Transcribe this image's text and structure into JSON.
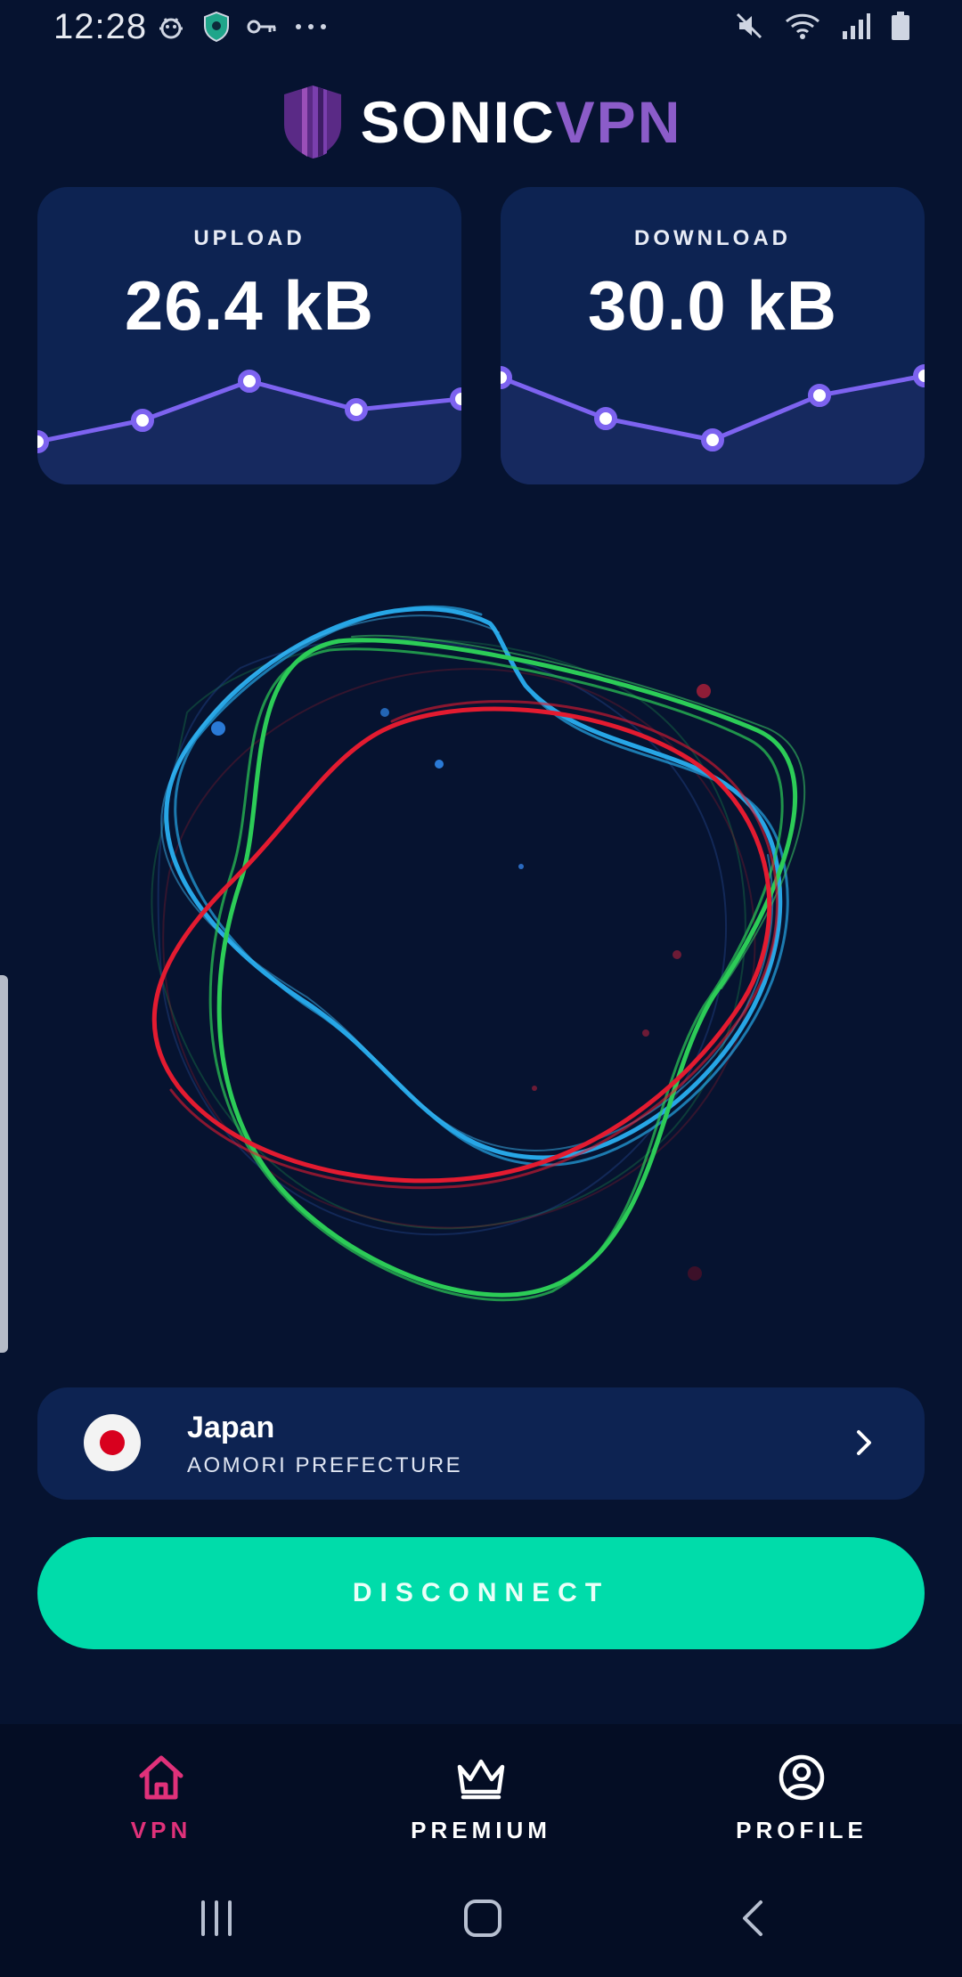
{
  "status_bar": {
    "time": "12:28",
    "left_icons": [
      "bug-icon",
      "shield-icon",
      "key-icon",
      "more-dots-icon"
    ],
    "right_icons": [
      "mute-icon",
      "wifi-icon",
      "signal-icon",
      "battery-icon"
    ]
  },
  "app": {
    "logo_word_1": "SONIC",
    "logo_word_2": "VPN",
    "brand_purple": "#8b5cc9"
  },
  "stats": {
    "upload": {
      "label": "UPLOAD",
      "value": "26.4 kB"
    },
    "download": {
      "label": "DOWNLOAD",
      "value": "30.0 kB"
    }
  },
  "location": {
    "country": "Japan",
    "region": "AOMORI PREFECTURE",
    "flag": "japan-flag"
  },
  "actions": {
    "disconnect_label": "DISCONNECT",
    "accent": "#00dcaa"
  },
  "bottom_nav": {
    "items": [
      {
        "label": "VPN",
        "icon": "home-icon",
        "active": true
      },
      {
        "label": "PREMIUM",
        "icon": "crown-icon",
        "active": false
      },
      {
        "label": "PROFILE",
        "icon": "user-circle-icon",
        "active": false
      }
    ],
    "active_color": "#e0317a"
  },
  "system_nav": [
    "recents-button",
    "home-button",
    "back-button"
  ]
}
